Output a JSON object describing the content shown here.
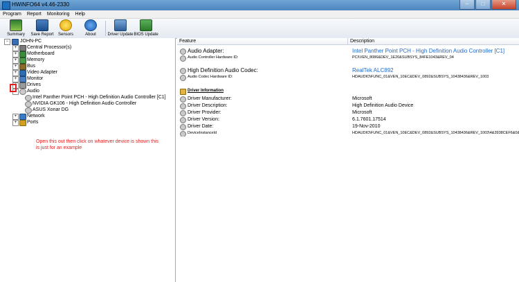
{
  "window": {
    "title": "HWiNFO64 v4.46-2330"
  },
  "window_buttons": [
    "–",
    "□",
    "✕"
  ],
  "menu": [
    "Program",
    "Report",
    "Monitoring",
    "Help"
  ],
  "toolbar": [
    {
      "label": "Summary",
      "icon": "monitor-summary-icon"
    },
    {
      "label": "Save Report",
      "icon": "save-report-icon"
    },
    {
      "label": "Sensors",
      "icon": "sensors-icon"
    },
    {
      "label": "About",
      "icon": "about-icon"
    },
    {
      "label": "Driver Update",
      "icon": "driver-update-icon"
    },
    {
      "label": "BIOS Update",
      "icon": "bios-update-icon"
    }
  ],
  "tree": {
    "root": "JOHN-PC",
    "items": [
      "Central Processor(s)",
      "Motherboard",
      "Memory",
      "Bus",
      "Video Adapter",
      "Monitor",
      "Drives",
      "Audio"
    ],
    "audio_children": [
      "Intel Panther Point PCH - High Definition Audio Controller [C1]",
      "NVIDIA GK106 - High Definition Audio Controller",
      "ASUS Xonar DG"
    ],
    "after_items": [
      "Network",
      "Ports"
    ],
    "expander_plus": "+",
    "expander_minus": "−"
  },
  "annotation": {
    "text": "Open this out then click on whatever device is shown this is just for an example",
    "color": "#e11d1d"
  },
  "columns": {
    "feature": "Feature",
    "description": "Description"
  },
  "details": [
    {
      "feature": "Audio Adapter:",
      "description": "Intel Panther Point PCH - High Definition Audio Controller [C1]",
      "style": "big",
      "desc_style": "link"
    },
    {
      "feature": "Audio Controller Hardware ID:",
      "description": "PCI\\VEN_8086&DEV_1E20&SUBSYS_84FE1043&REV_04",
      "style": "small"
    },
    {
      "feature": "High Definition Audio Codec:",
      "description": "RealTek ALC892",
      "style": "big",
      "desc_style": "link"
    },
    {
      "feature": "Audio Codec Hardware ID:",
      "description": "HDAUDIO\\FUNC_01&VEN_10EC&DEV_0892&SUBSYS_10438436&REV_1003",
      "style": "small"
    },
    {
      "feature": "Driver Information",
      "description": "",
      "style": "section"
    },
    {
      "feature": "Driver Manufacturer:",
      "description": "Microsoft",
      "style": "normal"
    },
    {
      "feature": "Driver Description:",
      "description": "High Definition Audio Device",
      "style": "normal"
    },
    {
      "feature": "Driver Provider:",
      "description": "Microsoft",
      "style": "normal"
    },
    {
      "feature": "Driver Version:",
      "description": "6.1.7601.17514",
      "style": "normal"
    },
    {
      "feature": "Driver Date:",
      "description": "19-Nov-2010",
      "style": "normal"
    },
    {
      "feature": "DeviceInstanceId",
      "description": "HDAUDIO\\FUNC_01&VEN_10EC&DEV_0892&SUBSYS_10438436&REV_1003\\4&3938CEF6&0&0001",
      "style": "small"
    }
  ]
}
